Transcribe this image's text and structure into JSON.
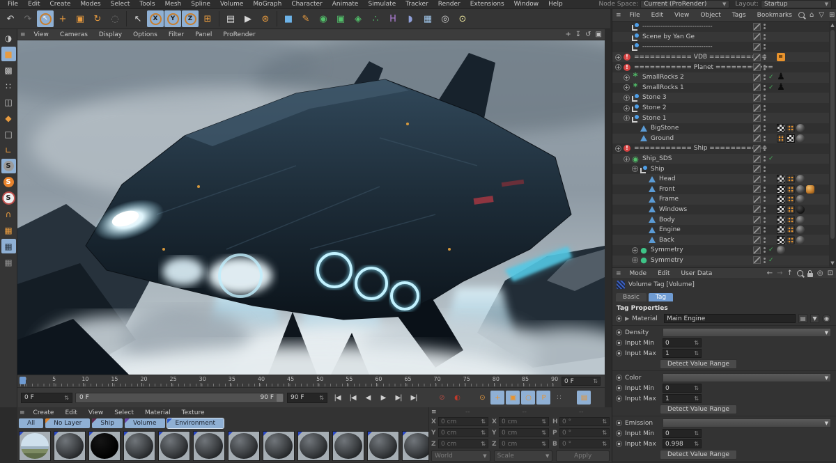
{
  "colors": {
    "accent_orange": "#e89b3f",
    "active_blue": "#8fb0d4",
    "tab_blue": "#6f9bd2",
    "check_green": "#48b05c",
    "alert_red": "#d84343",
    "engine_cyan": "#7fd9f2"
  },
  "menubar": {
    "items": [
      "File",
      "Edit",
      "Create",
      "Modes",
      "Select",
      "Tools",
      "Mesh",
      "Spline",
      "Volume",
      "MoGraph",
      "Character",
      "Animate",
      "Simulate",
      "Tracker",
      "Render",
      "Extensions",
      "Window",
      "Help"
    ],
    "node_space_label": "Node Space:",
    "node_space_value": "Current (ProRender)",
    "layout_label": "Layout:",
    "layout_value": "Startup"
  },
  "toolbar": [
    {
      "name": "undo",
      "glyph": "↶",
      "color": "#d0d0d0"
    },
    {
      "name": "redo",
      "glyph": "↷",
      "color": "#6d6d6d"
    },
    {
      "name": "live-selection",
      "glyph": "↖",
      "color": "#efefef",
      "active": true,
      "ring": true
    },
    {
      "name": "move",
      "glyph": "+",
      "color": "#e89b3f"
    },
    {
      "name": "scale",
      "glyph": "▣",
      "color": "#e89b3f"
    },
    {
      "name": "rotate",
      "glyph": "↻",
      "color": "#e89b3f"
    },
    {
      "name": "last-tool",
      "glyph": "◌",
      "color": "#7a7a7a"
    },
    {
      "sep": true
    },
    {
      "name": "selection",
      "glyph": "↖",
      "color": "#d8d8d8"
    },
    {
      "name": "lock-x-axis",
      "glyph": "X",
      "color": "#1e1e1e",
      "active": true,
      "ring": true
    },
    {
      "name": "lock-y-axis",
      "glyph": "Y",
      "color": "#1e1e1e",
      "active": true,
      "ring": true
    },
    {
      "name": "lock-z-axis",
      "glyph": "Z",
      "color": "#1e1e1e",
      "active": true,
      "ring": true
    },
    {
      "name": "coord-system",
      "glyph": "⊞",
      "color": "#e89b3f"
    },
    {
      "sep": true
    },
    {
      "name": "render-view",
      "glyph": "▤",
      "color": "#d8d8d8"
    },
    {
      "name": "render-picture-viewer",
      "glyph": "▶",
      "color": "#d8d8d8"
    },
    {
      "name": "render-settings",
      "glyph": "⊛",
      "color": "#e89b3f"
    },
    {
      "sep": true
    },
    {
      "name": "add-cube",
      "glyph": "■",
      "color": "#6db3e8"
    },
    {
      "name": "pen-spline",
      "glyph": "✎",
      "color": "#e89b3f"
    },
    {
      "name": "subdivision-surface",
      "glyph": "◉",
      "color": "#52c06a"
    },
    {
      "name": "deformer",
      "glyph": "▣",
      "color": "#52c06a"
    },
    {
      "name": "generator",
      "glyph": "◈",
      "color": "#52c06a"
    },
    {
      "name": "volume-generator",
      "glyph": "∴",
      "color": "#52c06a"
    },
    {
      "name": "field",
      "glyph": "H",
      "color": "#b07fd8"
    },
    {
      "name": "spline-primitive",
      "glyph": "◗",
      "color": "#8f9fd8"
    },
    {
      "name": "floor",
      "glyph": "▦",
      "color": "#9fc4e8"
    },
    {
      "name": "camera",
      "glyph": "◎",
      "color": "#d0d0d0"
    },
    {
      "name": "light",
      "glyph": "⊙",
      "color": "#e8e29b"
    }
  ],
  "left_dock": [
    {
      "name": "make-editable",
      "glyph": "◑",
      "color": "#c8c8c8"
    },
    {
      "name": "model-mode",
      "glyph": "■",
      "color": "#e89b3f",
      "active": true
    },
    {
      "name": "texture-mode",
      "glyph": "▩",
      "color": "#cccccc"
    },
    {
      "name": "point-mode",
      "glyph": "∷",
      "color": "#cccccc"
    },
    {
      "name": "edge-mode",
      "glyph": "◫",
      "color": "#cccccc"
    },
    {
      "name": "polygon-mode",
      "glyph": "◆",
      "color": "#e89b3f"
    },
    {
      "name": "tweak-mode",
      "glyph": "□",
      "color": "#cccccc"
    },
    {
      "name": "axis-mode",
      "glyph": "∟",
      "color": "#e89b3f"
    },
    {
      "name": "viewport-solo-off",
      "glyph": "S",
      "color": "#1e1e1e",
      "circle": "#9a9a9a",
      "active": true
    },
    {
      "name": "viewport-solo-single",
      "glyph": "S",
      "color": "#ffffff",
      "circle": "#e8832d"
    },
    {
      "name": "viewport-solo-hierarchy",
      "glyph": "S",
      "color": "#1e1e1e",
      "circle": "#f0f0f0",
      "ring": "#c0504d"
    },
    {
      "name": "snap",
      "glyph": "∩",
      "color": "#e89b3f"
    },
    {
      "name": "workplane",
      "glyph": "▦",
      "color": "#e89b3f"
    },
    {
      "name": "plane-mode",
      "glyph": "▦",
      "color": "#2e3a46",
      "active": true
    },
    {
      "name": "lock-workplane",
      "glyph": "▦",
      "color": "#8a8a8a"
    }
  ],
  "viewport": {
    "menu": [
      "View",
      "Cameras",
      "Display",
      "Options",
      "Filter",
      "Panel",
      "ProRender"
    ],
    "corner_icons": [
      {
        "name": "pan-view",
        "glyph": "+"
      },
      {
        "name": "dolly-view",
        "glyph": "↧"
      },
      {
        "name": "rotate-view",
        "glyph": "↺"
      },
      {
        "name": "toggle-view",
        "glyph": "▣"
      }
    ]
  },
  "timeline": {
    "ticks": [
      "0",
      "5",
      "10",
      "15",
      "20",
      "25",
      "30",
      "35",
      "40",
      "45",
      "50",
      "55",
      "60",
      "65",
      "70",
      "75",
      "80",
      "85",
      "90"
    ],
    "current_frame": "0 F"
  },
  "transport": {
    "frame_field": "0 F",
    "range_start": "0 F",
    "range_end": "90 F",
    "end_field": "90 F",
    "buttons": [
      {
        "name": "goto-start",
        "glyph": "|◀"
      },
      {
        "name": "prev-key",
        "glyph": "|◀"
      },
      {
        "name": "prev-frame",
        "glyph": "◀"
      },
      {
        "name": "play",
        "glyph": "▶"
      },
      {
        "name": "next-frame",
        "glyph": "▶|"
      },
      {
        "name": "goto-end",
        "glyph": "▶|"
      },
      {
        "gap": 16
      },
      {
        "name": "record-simulation",
        "glyph": "⊘",
        "color": "#b04a42"
      },
      {
        "name": "autokeying",
        "glyph": "◐",
        "color": "#c0392b"
      },
      {
        "gap": 12
      },
      {
        "name": "record-keyframe",
        "glyph": "⊙",
        "color": "#e89b3f"
      },
      {
        "name": "key-position",
        "glyph": "+",
        "color": "#e8932d",
        "active": true
      },
      {
        "name": "key-scale",
        "glyph": "▣",
        "color": "#e8932d",
        "active": true
      },
      {
        "name": "key-rotation",
        "glyph": "○",
        "color": "#e8932d",
        "active": true
      },
      {
        "name": "key-parameter",
        "glyph": "P",
        "color": "#e8932d",
        "active": true
      },
      {
        "name": "key-pla",
        "glyph": "∷",
        "color": "#8a8a8a"
      },
      {
        "gap": 12
      },
      {
        "name": "timeline-window",
        "glyph": "▤",
        "color": "#e8932d",
        "active": true
      }
    ]
  },
  "material_manager": {
    "menu": [
      "Create",
      "Edit",
      "View",
      "Select",
      "Material",
      "Texture"
    ],
    "tabs": [
      {
        "label": "All"
      },
      {
        "label": "No Layer",
        "corner": "#e0862d"
      },
      {
        "label": "Ship",
        "corner": "#5c2a4a"
      },
      {
        "label": "Volume",
        "corner": "#6a48b0"
      },
      {
        "label": "Environment",
        "corner": "#2b58c8",
        "selected": true
      }
    ],
    "materials": [
      {
        "kind": "environment"
      },
      {
        "kind": "rock"
      },
      {
        "kind": "black"
      },
      {
        "kind": "rock"
      },
      {
        "kind": "rock"
      },
      {
        "kind": "rock"
      },
      {
        "kind": "rock"
      },
      {
        "kind": "rock"
      },
      {
        "kind": "rock"
      },
      {
        "kind": "rock"
      },
      {
        "kind": "rock"
      },
      {
        "kind": "rock"
      }
    ]
  },
  "coordinates": {
    "header_cols": [
      "--",
      "--",
      "--"
    ],
    "position_rows": [
      {
        "label": "X",
        "value": "0 cm"
      },
      {
        "label": "Y",
        "value": "0 cm"
      },
      {
        "label": "Z",
        "value": "0 cm"
      }
    ],
    "scale_rows": [
      {
        "label": "X",
        "value": "0 cm"
      },
      {
        "label": "Y",
        "value": "0 cm"
      },
      {
        "label": "Z",
        "value": "0 cm"
      }
    ],
    "rotation_rows": [
      {
        "label": "H",
        "value": "0 °"
      },
      {
        "label": "P",
        "value": "0 °"
      },
      {
        "label": "B",
        "value": "0 °"
      }
    ],
    "mode_dropdown": "World",
    "scale_dropdown": "Scale",
    "apply_label": "Apply"
  },
  "object_manager": {
    "menu": [
      "File",
      "Edit",
      "View",
      "Object",
      "Tags",
      "Bookmarks"
    ],
    "glyphs": {
      "alert": "!",
      "gear": "*",
      "sds": "◉",
      "sym": "●",
      "head": "♟",
      "expand": "+"
    },
    "rows": [
      {
        "indent": 1,
        "icon": "null",
        "label": "-------------------------------"
      },
      {
        "indent": 1,
        "icon": "null",
        "label": "Scene by Yan Ge"
      },
      {
        "indent": 1,
        "icon": "null",
        "label": "-------------------------------"
      },
      {
        "indent": 0,
        "expand": true,
        "icon": "alert",
        "label": "=========== VDB ===========",
        "tags": [
          "note"
        ]
      },
      {
        "indent": 0,
        "expand": true,
        "icon": "alert",
        "label": "=========== Planet ==========="
      },
      {
        "indent": 1,
        "expand": true,
        "icon": "gear",
        "label": "SmallRocks 2",
        "check": true,
        "tags": [
          "head"
        ]
      },
      {
        "indent": 1,
        "expand": true,
        "icon": "gear",
        "label": "SmallRocks 1",
        "check": true,
        "tags": [
          "head"
        ]
      },
      {
        "indent": 1,
        "expand": true,
        "icon": "null",
        "label": "Stone 3"
      },
      {
        "indent": 1,
        "expand": true,
        "icon": "null",
        "label": "Stone 2"
      },
      {
        "indent": 1,
        "expand": true,
        "icon": "null",
        "label": "Stone 1"
      },
      {
        "indent": 2,
        "icon": "poly",
        "label": "BigStone",
        "tags": [
          "checker",
          "dots",
          "sphere"
        ]
      },
      {
        "indent": 2,
        "icon": "poly",
        "label": "Ground",
        "tags": [
          "dots",
          "checker",
          "sphere"
        ]
      },
      {
        "indent": 0,
        "expand": true,
        "icon": "alert",
        "label": "=========== Ship ==========="
      },
      {
        "indent": 1,
        "expand": true,
        "icon": "sds",
        "label": "Ship_SDS",
        "check": true
      },
      {
        "indent": 2,
        "expand": true,
        "icon": "null",
        "label": "Ship"
      },
      {
        "indent": 3,
        "icon": "poly",
        "label": "Head",
        "tags": [
          "checker",
          "dots",
          "sphere"
        ]
      },
      {
        "indent": 3,
        "icon": "poly",
        "label": "Front",
        "tags": [
          "checker",
          "dots",
          "sphere",
          "gold"
        ]
      },
      {
        "indent": 3,
        "icon": "poly",
        "label": "Frame",
        "tags": [
          "checker",
          "dots",
          "sphere"
        ]
      },
      {
        "indent": 3,
        "icon": "poly",
        "label": "Windows",
        "tags": [
          "checker",
          "dots",
          "sphere-dark"
        ]
      },
      {
        "indent": 3,
        "icon": "poly",
        "label": "Body",
        "tags": [
          "checker",
          "dots",
          "sphere"
        ]
      },
      {
        "indent": 3,
        "icon": "poly",
        "label": "Engine",
        "tags": [
          "checker",
          "dots",
          "sphere"
        ]
      },
      {
        "indent": 3,
        "icon": "poly",
        "label": "Back",
        "tags": [
          "checker",
          "dots",
          "sphere"
        ]
      },
      {
        "indent": 2,
        "expand": true,
        "icon": "sym",
        "label": "Symmetry",
        "check": true,
        "tags": [
          "sphere"
        ]
      },
      {
        "indent": 2,
        "expand": true,
        "icon": "sym",
        "label": "Symmetry",
        "check": true
      }
    ],
    "header_icons": [
      {
        "name": "search",
        "type": "mag"
      },
      {
        "name": "scene-path",
        "glyph": "⌂"
      },
      {
        "name": "filter",
        "glyph": "▽"
      },
      {
        "name": "add-panel",
        "glyph": "⊞"
      }
    ]
  },
  "attributes": {
    "menu": [
      "Mode",
      "Edit",
      "User Data"
    ],
    "header_icons": [
      {
        "name": "history-back",
        "glyph": "←"
      },
      {
        "name": "history-forward",
        "glyph": "→",
        "dim": true
      },
      {
        "name": "parent-up",
        "glyph": "↑"
      },
      {
        "name": "search",
        "type": "mag"
      },
      {
        "name": "lock",
        "type": "lock"
      },
      {
        "name": "sync",
        "glyph": "◎"
      },
      {
        "name": "new-panel",
        "glyph": "⊡"
      }
    ],
    "title": "Volume Tag [Volume]",
    "tabs": [
      {
        "label": "Basic"
      },
      {
        "label": "Tag",
        "active": true
      }
    ],
    "section": "Tag Properties",
    "material_label": "Material",
    "material_value": "Main Engine",
    "groups": [
      {
        "channel": "Density",
        "rows": [
          {
            "label": "Input Min",
            "value": "0"
          },
          {
            "label": "Input Max",
            "value": "1"
          }
        ],
        "button": "Detect Value Range"
      },
      {
        "channel": "Color",
        "rows": [
          {
            "label": "Input Min",
            "value": "0"
          },
          {
            "label": "Input Max",
            "value": "1"
          }
        ],
        "button": "Detect Value Range"
      },
      {
        "channel": "Emission",
        "rows": [
          {
            "label": "Input Min",
            "value": "0"
          },
          {
            "label": "Input Max",
            "value": "0.998"
          }
        ],
        "button": "Detect Value Range"
      }
    ]
  }
}
